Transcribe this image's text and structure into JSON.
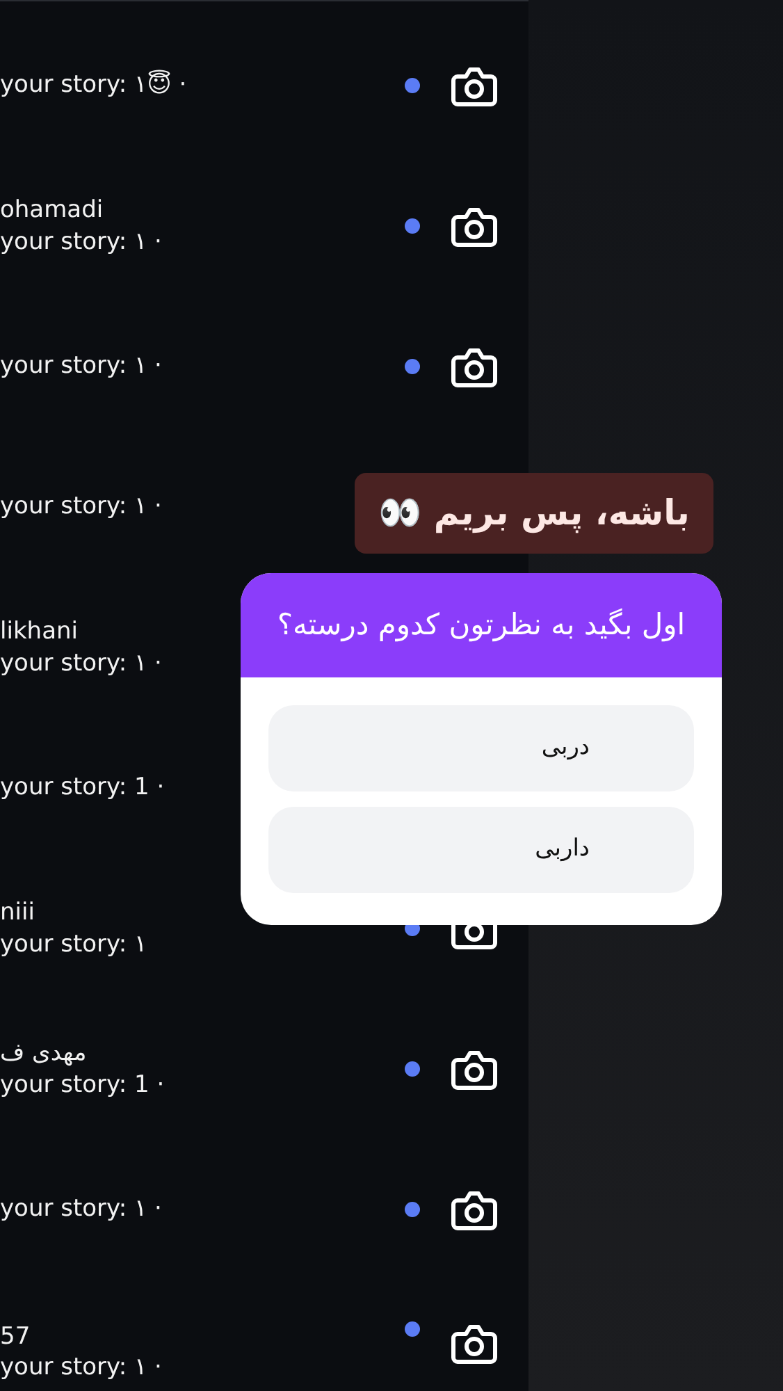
{
  "rows": [
    {
      "subtitle": "your story: ۱😇 ·",
      "unread": true
    },
    {
      "name": "ohamadi",
      "subtitle": "your story: ۱ ·",
      "unread": true
    },
    {
      "subtitle": "your story: ۱ ·",
      "unread": true
    },
    {
      "subtitle": "your story: ۱ ·"
    },
    {
      "name": "likhani",
      "subtitle": "your story: ۱ ·"
    },
    {
      "subtitle": "your story: 1 ·"
    },
    {
      "name": "niii",
      "subtitle": "your story: ۱",
      "unread": true
    },
    {
      "name": "مهدی ف",
      "subtitle": "your story: 1 ·",
      "unread": true
    },
    {
      "subtitle": "your story: ۱ ·",
      "unread": true
    },
    {
      "name": "57",
      "subtitle": "your story: ۱ ·",
      "unread": true
    }
  ],
  "sticker": {
    "text": "باشه، پس بریم 👀"
  },
  "poll": {
    "question": "اول بگید به نظرتون کدوم درسته؟",
    "options": [
      {
        "label": "دربی",
        "selected": false
      },
      {
        "label": "داربی",
        "selected": false
      }
    ]
  }
}
